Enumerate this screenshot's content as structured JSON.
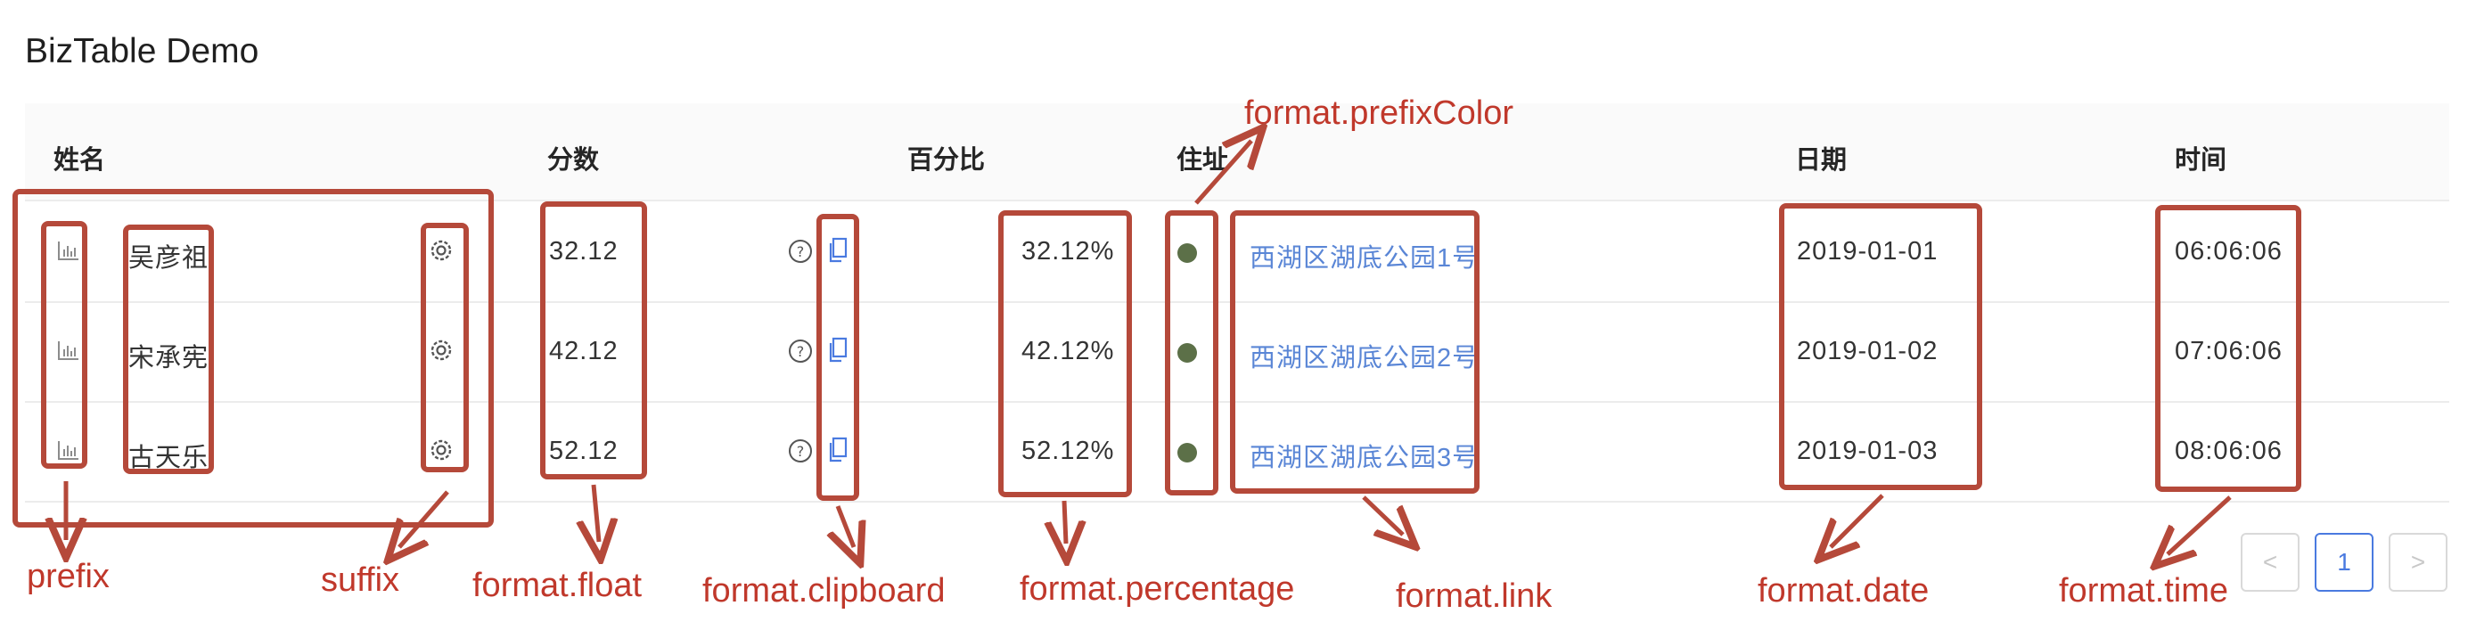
{
  "title": "BizTable Demo",
  "columns": {
    "name": "姓名",
    "score": "分数",
    "percent": "百分比",
    "address": "住址",
    "date": "日期",
    "time": "时间"
  },
  "rows": [
    {
      "name": "吴彦祖",
      "score": "32.12",
      "percent": "32.12%",
      "address": "西湖区湖底公园1号",
      "date": "2019-01-01",
      "time": "06:06:06"
    },
    {
      "name": "宋承宪",
      "score": "42.12",
      "percent": "42.12%",
      "address": "西湖区湖底公园2号",
      "date": "2019-01-02",
      "time": "07:06:06"
    },
    {
      "name": "古天乐",
      "score": "52.12",
      "percent": "52.12%",
      "address": "西湖区湖底公园3号",
      "date": "2019-01-03",
      "time": "08:06:06"
    }
  ],
  "pagination": {
    "prev": "<",
    "current": "1",
    "next": ">"
  },
  "annotations": {
    "prefixColor": "format.prefixColor",
    "prefix": "prefix",
    "suffix": "suffix",
    "float": "format.float",
    "clipboard": "format.clipboard",
    "percentage": "format.percentage",
    "link": "format.link",
    "date": "format.date",
    "time": "format.time"
  },
  "icons": {
    "prefix": "bar-chart-icon",
    "suffix": "gear-icon",
    "help": "question-circle-icon",
    "copy": "copy-icon"
  },
  "colors": {
    "annotation": "#b5493a",
    "link": "#5a86d6",
    "dot": "#5c7048",
    "pager_active": "#4a7ae0"
  }
}
